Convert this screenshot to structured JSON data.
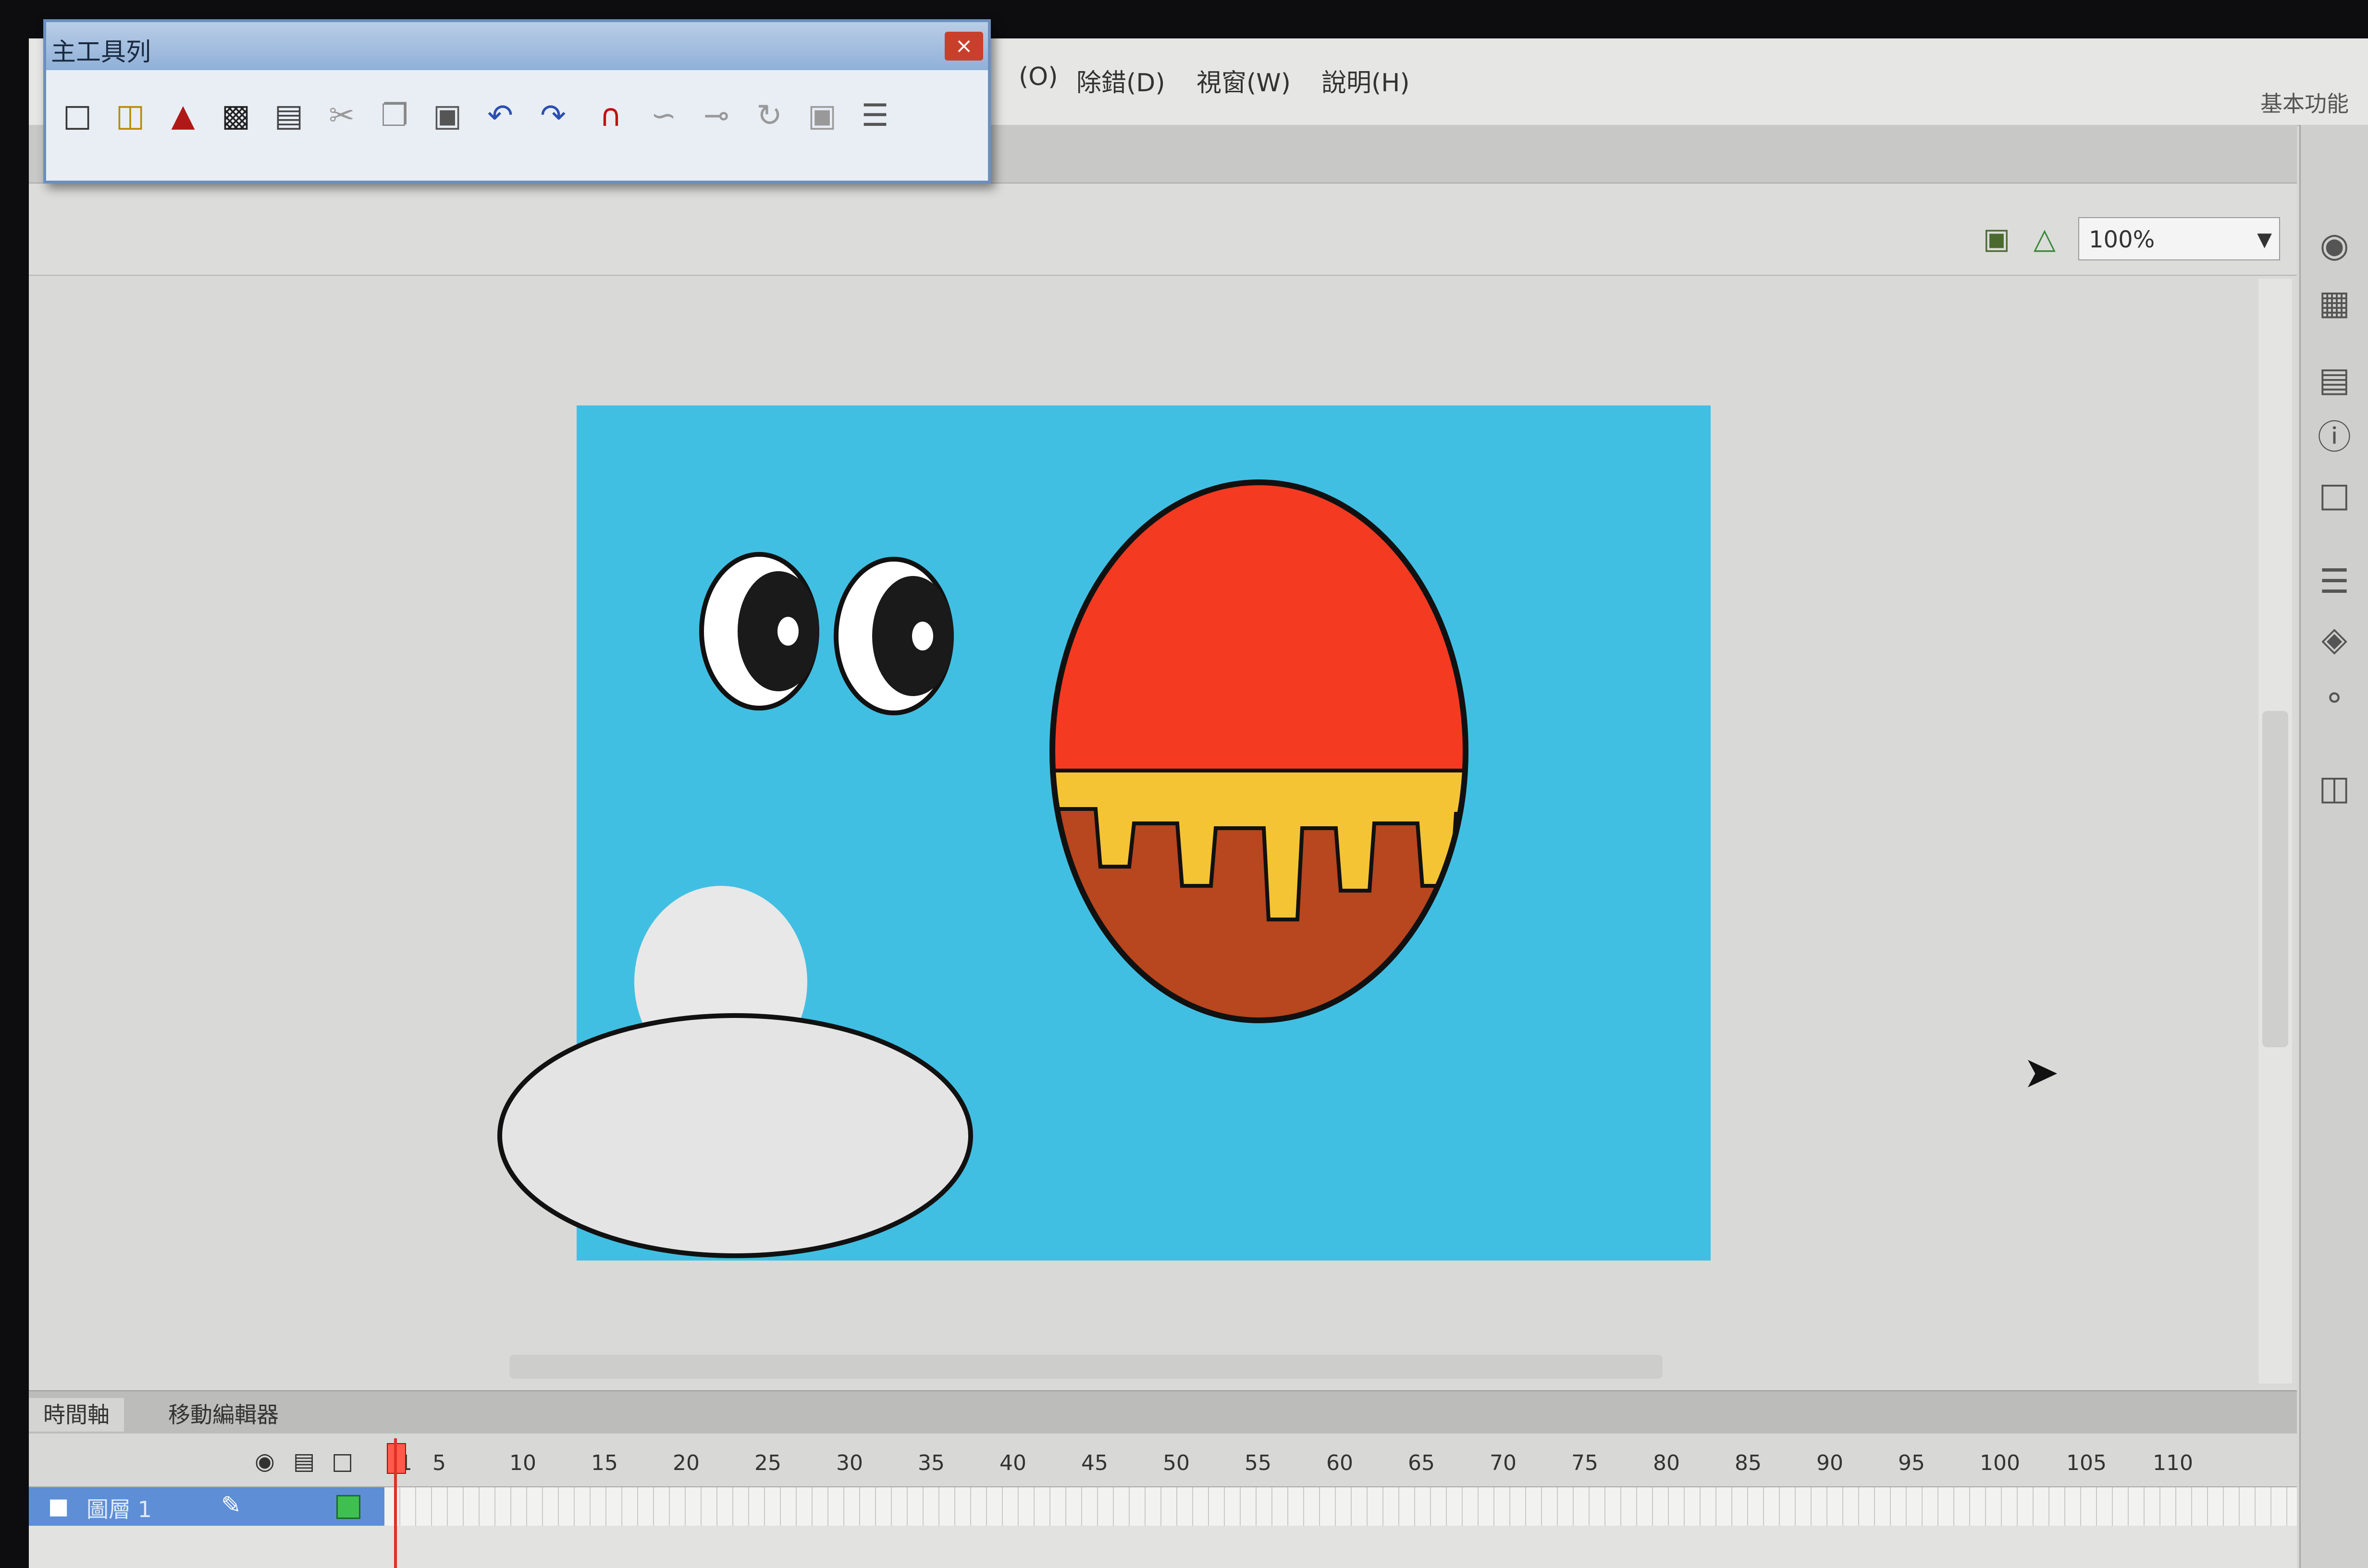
{
  "menubar": {
    "items": [
      "(O)",
      "除錯(D)",
      "視窗(W)",
      "說明(H)"
    ],
    "workspace": "基本功能"
  },
  "toolbar_window": {
    "title": "主工具列",
    "close": "×",
    "buttons": [
      "new-icon",
      "open-icon",
      "bridge-icon",
      "save-icon",
      "print-icon",
      "cut-icon",
      "copy-icon",
      "paste-icon",
      "undo-icon",
      "redo-icon",
      "snap-magnet-icon",
      "smooth-icon",
      "straighten-icon",
      "rotate-icon",
      "scale-icon",
      "align-icon"
    ]
  },
  "stagebar": {
    "zoom": "100%"
  },
  "timeline": {
    "tabs": [
      "時間軸",
      "移動編輯器"
    ],
    "frame_numbers": [
      "1",
      "5",
      "10",
      "15",
      "20",
      "25",
      "30",
      "35",
      "40",
      "45",
      "50",
      "55",
      "60",
      "65",
      "70",
      "75",
      "80",
      "85",
      "90",
      "95",
      "100",
      "105",
      "110"
    ],
    "layer_name": "圖層 1"
  },
  "colors": {
    "stage": "#41bfe2",
    "egg_top": "#f53a22",
    "egg_bottom": "#b8461e",
    "egg_band": "#f5c435",
    "playhead": "#e0302a"
  }
}
